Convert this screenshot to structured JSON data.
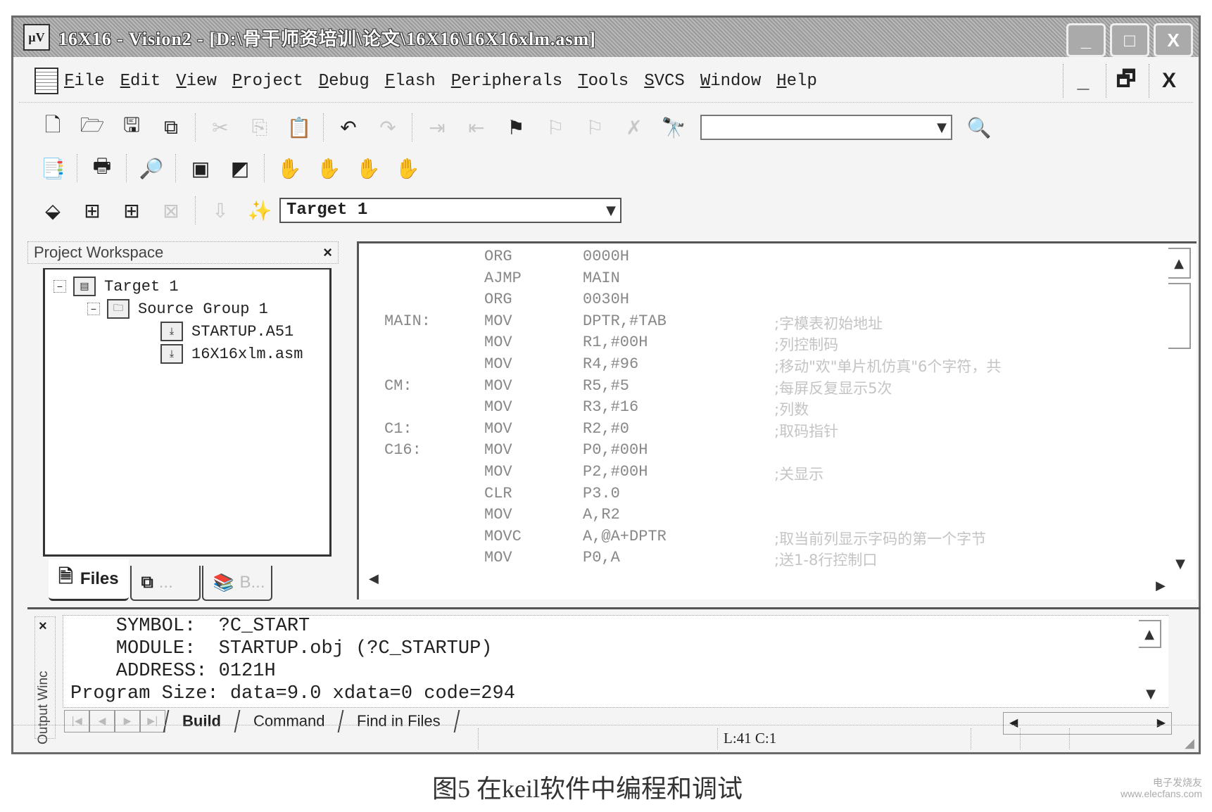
{
  "window": {
    "title": "16X16  - Vision2 - [D:\\骨干师资培训\\论文\\16X16\\16X16xlm.asm]",
    "app_icon": "uv-icon",
    "controls": {
      "minimize": "_",
      "maximize": "□",
      "close": "X"
    }
  },
  "menubar": {
    "items": [
      "File",
      "Edit",
      "View",
      "Project",
      "Debug",
      "Flash",
      "Peripherals",
      "Tools",
      "SVCS",
      "Window",
      "Help"
    ],
    "mdi_controls": {
      "minimize": "_",
      "restore": "🗗",
      "close": "X"
    }
  },
  "toolbar": {
    "row1": [
      "new-file",
      "open-file",
      "save",
      "save-all",
      "cut",
      "copy",
      "paste",
      "undo",
      "redo",
      "indent",
      "unindent",
      "bookmark-toggle",
      "bookmark-prev",
      "bookmark-next",
      "bookmark-clear",
      "find-in-files"
    ],
    "find_combo_value": "",
    "row2": [
      "project-window",
      "print",
      "find",
      "workspace-toggle",
      "output-toggle",
      "halt",
      "breakpoint-toggle",
      "breakpoint-disable",
      "breakpoint-kill"
    ],
    "row3": [
      "translate",
      "build-target",
      "rebuild-all",
      "stop-build",
      "load",
      "options-for-target"
    ],
    "target_combo_value": "Target 1"
  },
  "workspace": {
    "title": "Project Workspace",
    "tree": [
      {
        "label": "Target 1",
        "level": 0,
        "expanded": true
      },
      {
        "label": "Source Group 1",
        "level": 1,
        "expanded": true
      },
      {
        "label": "STARTUP.A51",
        "level": 2
      },
      {
        "label": "16X16xlm.asm",
        "level": 2
      }
    ],
    "tabs": [
      {
        "label": "Files",
        "active": true
      },
      {
        "label": "...",
        "active": false
      },
      {
        "label": "B...",
        "active": false
      }
    ]
  },
  "editor": {
    "lines": [
      {
        "label": "",
        "op": "ORG",
        "arg": "0000H",
        "comment": ""
      },
      {
        "label": "",
        "op": "AJMP",
        "arg": "MAIN",
        "comment": ""
      },
      {
        "label": "",
        "op": "ORG",
        "arg": "0030H",
        "comment": ""
      },
      {
        "label": "MAIN:",
        "op": "MOV",
        "arg": "DPTR,#TAB",
        "comment": ";字模表初始地址"
      },
      {
        "label": "",
        "op": "MOV",
        "arg": "R1,#00H",
        "comment": ";列控制码"
      },
      {
        "label": "",
        "op": "MOV",
        "arg": "R4,#96",
        "comment": ";移动\"欢\"单片机仿真\"6个字符，共"
      },
      {
        "label": "CM:",
        "op": "MOV",
        "arg": "R5,#5",
        "comment": ";每屏反复显示5次"
      },
      {
        "label": "",
        "op": "MOV",
        "arg": "R3,#16",
        "comment": ";列数"
      },
      {
        "label": "C1:",
        "op": "MOV",
        "arg": "R2,#0",
        "comment": ";取码指针"
      },
      {
        "label": "C16:",
        "op": "MOV",
        "arg": "P0,#00H",
        "comment": ""
      },
      {
        "label": "",
        "op": "MOV",
        "arg": "P2,#00H",
        "comment": ";关显示"
      },
      {
        "label": "",
        "op": "CLR",
        "arg": "P3.0",
        "comment": ""
      },
      {
        "label": "",
        "op": "MOV",
        "arg": "A,R2",
        "comment": ""
      },
      {
        "label": "",
        "op": "MOVC",
        "arg": "A,@A+DPTR",
        "comment": ";取当前列显示字码的第一个字节"
      },
      {
        "label": "",
        "op": "MOV",
        "arg": "P0,A",
        "comment": ";送1-8行控制口"
      }
    ]
  },
  "output": {
    "side_label": "Output Winc",
    "lines": [
      "    SYMBOL:  ?C_START",
      "    MODULE:  STARTUP.obj (?C_STARTUP)",
      "    ADDRESS: 0121H",
      "Program Size: data=9.0 xdata=0 code=294"
    ],
    "tabs": [
      {
        "label": "Build",
        "active": true
      },
      {
        "label": "Command",
        "active": false
      },
      {
        "label": "Find in Files",
        "active": false
      }
    ]
  },
  "statusbar": {
    "position": "L:41 C:1"
  },
  "caption": "图5  在keil软件中编程和调试",
  "watermark": {
    "line1": "电子发烧友",
    "line2": "www.elecfans.com"
  }
}
